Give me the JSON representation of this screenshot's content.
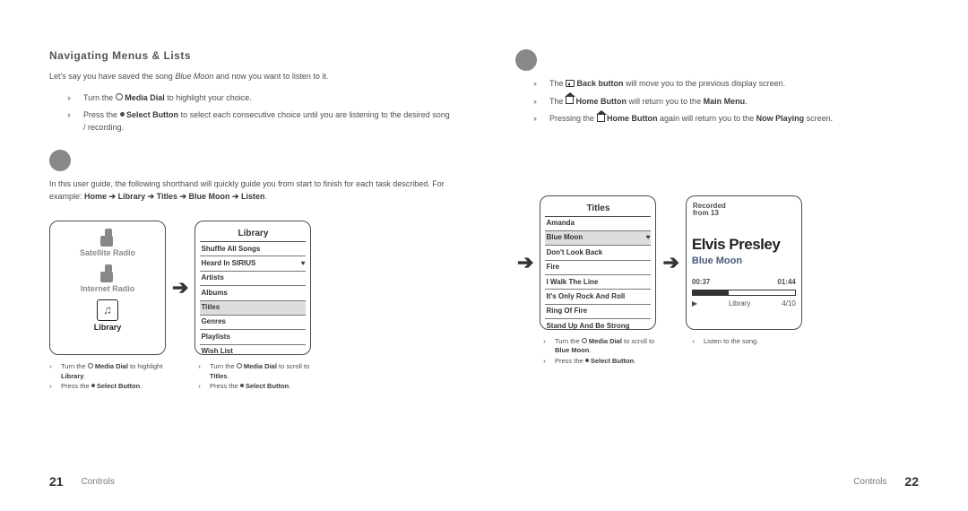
{
  "leftPage": {
    "heading": "Navigating Menus & Lists",
    "intro": "Let's say you have saved the song Blue Moon and now want to listen to it.",
    "bullets": [
      {
        "pre": "Turn the ",
        "icon": "ring",
        "mid": " Media Dial",
        "post": " to highlight your choice."
      },
      {
        "pre": "Press the ",
        "icon": "dot",
        "mid": " Select Button",
        "post": " to select each consecutive choice until you are listening to the desired song / recording."
      }
    ],
    "shorthand_intro": "In this user guide, the following shorthand will quickly guide you from start to finish for each task described. For example: ",
    "shorthand_path": "Home ➔ Library ➔ Titles ➔ Blue Moon ➔ Listen",
    "screens": {
      "home": {
        "items": [
          "Satellite Radio",
          "Internet Radio",
          "Library"
        ],
        "selected": 2
      },
      "library": {
        "title": "Library",
        "rows": [
          "Shuffle All Songs",
          "Heard In SIRIUS",
          "Artists",
          "Albums",
          "Titles",
          "Genres",
          "Playlists",
          "Wish List"
        ],
        "highlighted": "Titles",
        "heart_row": "Heard In SIRIUS"
      }
    },
    "captions": [
      {
        "lines": [
          {
            "pre": "Turn the ",
            "icon": "ring",
            "mid": " Media Dial",
            "post": " to highlight ",
            "bold": "Library",
            "end": "."
          },
          {
            "pre": "Press the ",
            "icon": "dot",
            "mid": " Select Button",
            "end": "."
          }
        ]
      },
      {
        "lines": [
          {
            "pre": "Turn the ",
            "icon": "ring",
            "mid": " Media Dial",
            "post": " to scroll to ",
            "bold": "Titles",
            "end": "."
          },
          {
            "pre": "Press the ",
            "icon": "dot",
            "mid": " Select Button",
            "end": "."
          }
        ]
      }
    ],
    "pageNum": "21",
    "footerLabel": "Controls"
  },
  "rightPage": {
    "bullets": [
      {
        "pre": "The ",
        "icon": "back",
        "mid": " Back button",
        "post": " will move you to the previous display screen."
      },
      {
        "pre": "The ",
        "icon": "home",
        "mid": " Home Button",
        "post": " will return you to the ",
        "bold": "Main Menu",
        "end": "."
      },
      {
        "pre": "Pressing the ",
        "icon": "home",
        "mid": " Home Button",
        "post": " again will return you to the ",
        "bold": "Now Playing",
        "end": " screen."
      }
    ],
    "screens": {
      "titles": {
        "title": "Titles",
        "rows": [
          "Amanda",
          "Blue Moon",
          "Don't Look Back",
          "Fire",
          "I Walk The Line",
          "It's Only Rock And Roll",
          "Ring Of Fire",
          "Stand Up And Be Strong"
        ],
        "highlighted": "Blue Moon",
        "heart_row": "Blue Moon"
      },
      "nowplaying": {
        "header1": "Recorded",
        "header2": "from 13",
        "artist": "Elvis Presley",
        "song": "Blue Moon",
        "t1": "00:37",
        "t2": "01:44",
        "footer_left": "",
        "footer_mid": "Library",
        "footer_right": "4/10"
      }
    },
    "captions": [
      {
        "lines": [
          {
            "pre": "Turn the ",
            "icon": "ring",
            "mid": " Media Dial",
            "post": " to scroll to ",
            "bold": "Blue Moon",
            "end": "."
          },
          {
            "pre": "Press the ",
            "icon": "dot",
            "mid": " Select Button",
            "end": "."
          }
        ]
      },
      {
        "lines": [
          {
            "plain": "Listen to the song."
          }
        ]
      }
    ],
    "pageNum": "22",
    "footerLabel": "Controls"
  }
}
